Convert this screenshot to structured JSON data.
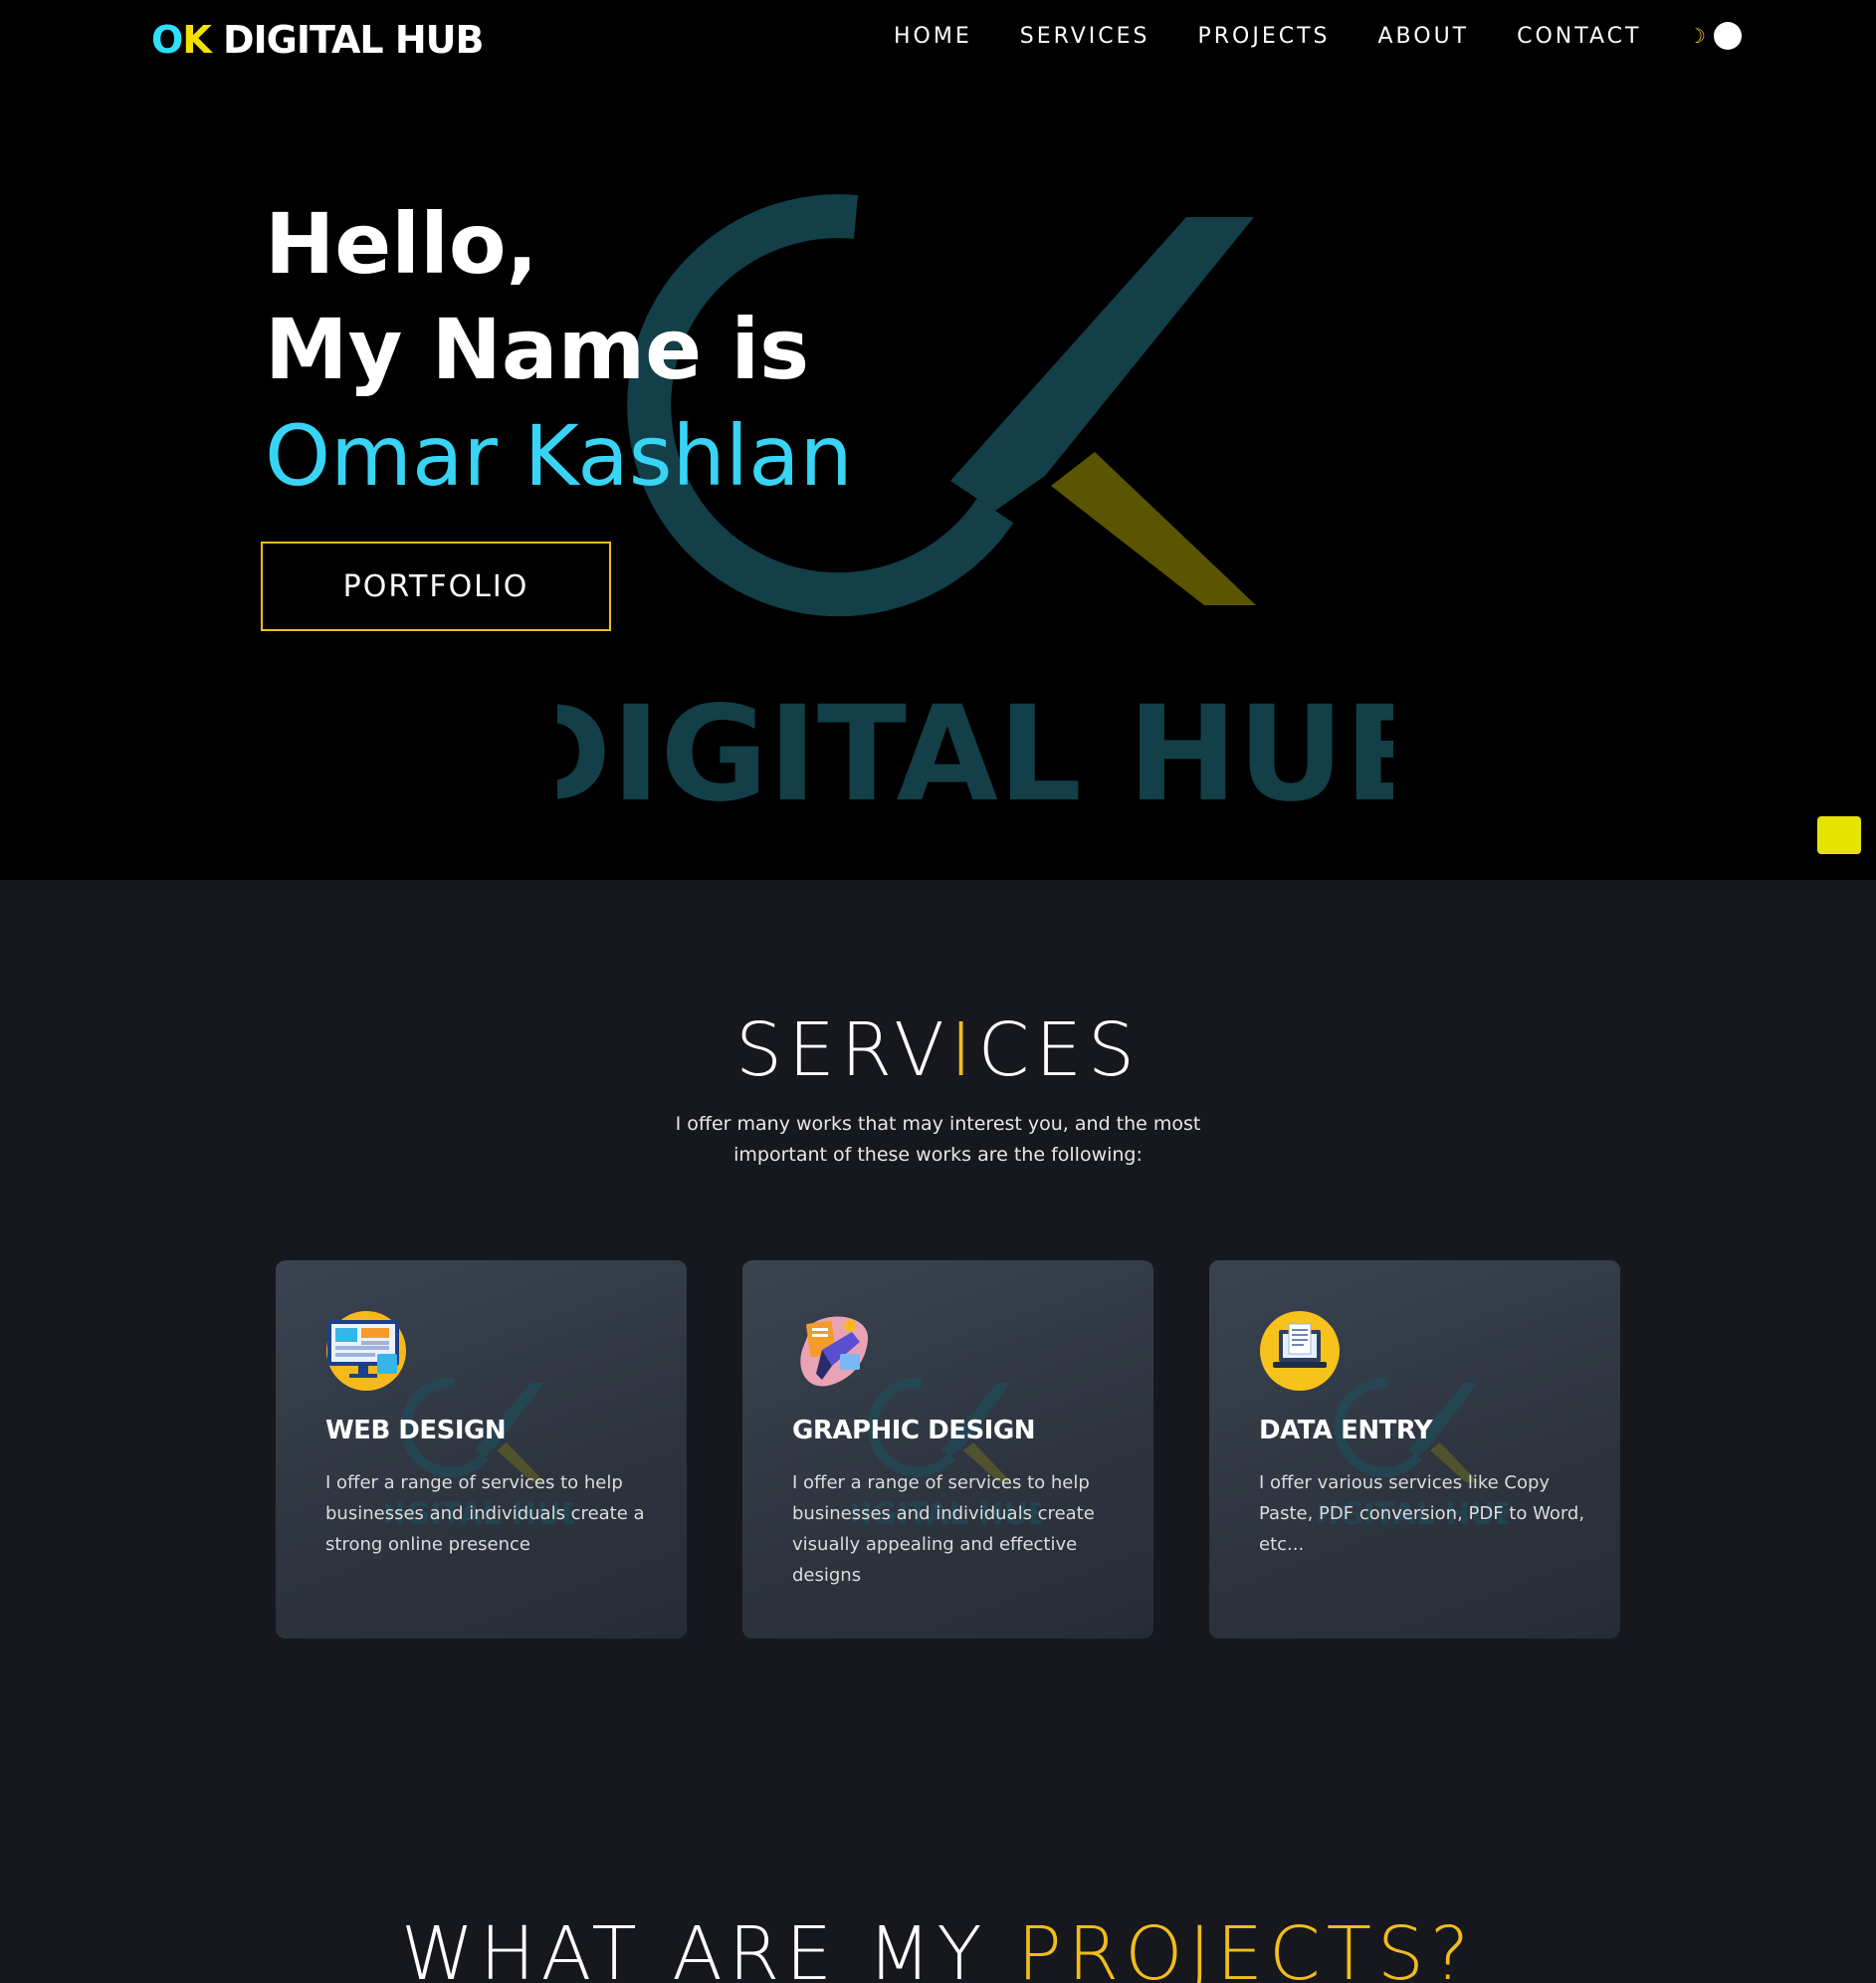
{
  "nav": {
    "brand_o": "O",
    "brand_k": "K",
    "brand_rest": " DIGITAL HUB",
    "links": [
      "HOME",
      "SERVICES",
      "PROJECTS",
      "ABOUT",
      "CONTACT"
    ],
    "theme_toggle_icon": "moon-icon"
  },
  "hero": {
    "line1": "Hello,",
    "line2": "My Name is",
    "name": "Omar Kashlan",
    "button": "PORTFOLIO",
    "watermark_text": "DIGITAL HUB",
    "colors": {
      "name": "#38d4f5",
      "button_border": "#f1bd1c",
      "scroll_button": "#e4e400"
    }
  },
  "services": {
    "title_a": "SERV",
    "title_hl": "I",
    "title_b": "CES",
    "subtitle": "I offer many works that may interest you, and the most important of these works are the following:",
    "cards": [
      {
        "icon": "web-design-icon",
        "title": "WEB DESIGN",
        "text": "I offer a range of services to help businesses and individuals create a strong online presence"
      },
      {
        "icon": "graphic-design-icon",
        "title": "GRAPHIC DESIGN",
        "text": "I offer a range of services to help businesses and individuals create visually appealing and effective designs"
      },
      {
        "icon": "data-entry-icon",
        "title": "DATA ENTRY",
        "text": "I offer various services like Copy Paste, PDF conversion, PDF to Word, etc..."
      }
    ],
    "accent": "#f1bd1c"
  },
  "projects": {
    "title_a": "WHAT ARE MY ",
    "title_hl": "PROJECTS?"
  }
}
